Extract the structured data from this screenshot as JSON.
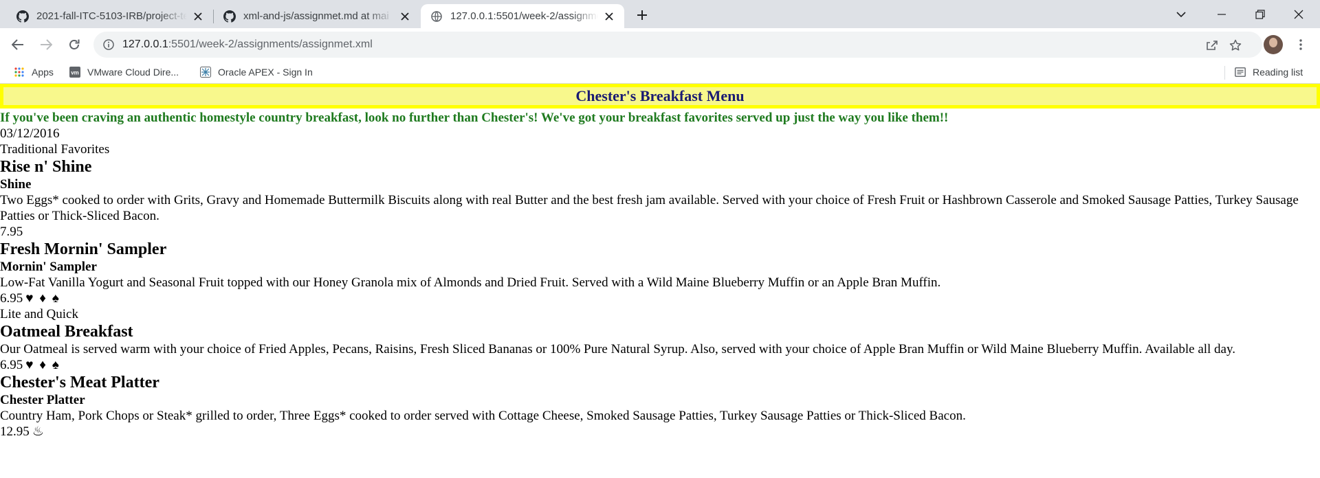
{
  "browser": {
    "tabs": [
      {
        "title": "2021-fall-ITC-5103-IRB/project-te",
        "icon": "github-icon",
        "active": false
      },
      {
        "title": "xml-and-js/assignmet.md at mai",
        "icon": "github-icon",
        "active": false
      },
      {
        "title": "127.0.0.1:5501/week-2/assignme",
        "icon": "globe-icon",
        "active": true
      }
    ],
    "url_host": "127.0.0.1",
    "url_rest": ":5501/week-2/assignments/assignmet.xml",
    "bookmarks": [
      {
        "label": "Apps",
        "icon": "apps-grid-icon"
      },
      {
        "label": "VMware Cloud Dire...",
        "icon": "vmware-icon"
      },
      {
        "label": "Oracle APEX - Sign In",
        "icon": "oracle-apex-icon"
      }
    ],
    "reading_list": "Reading list"
  },
  "menu": {
    "title": "Chester's Breakfast Menu",
    "intro": "If you've been craving an authentic homestyle country breakfast, look no further than Chester's! We've got your breakfast favorites served up just the way you like them!!",
    "date": "03/12/2016",
    "sections": [
      {
        "category": "Traditional Favorites",
        "items": [
          {
            "name": "Rise n' Shine",
            "short": "Shine",
            "description": "Two Eggs* cooked to order with Grits, Gravy and Homemade Buttermilk Biscuits along with real Butter and the best fresh jam available. Served with your choice of Fresh Fruit or Hashbrown Casserole and Smoked Sausage Patties, Turkey Sausage Patties or Thick-Sliced Bacon.",
            "price": "7.95",
            "symbols": ""
          },
          {
            "name": "Fresh Mornin' Sampler",
            "short": "Mornin' Sampler",
            "description": "Low-Fat Vanilla Yogurt and Seasonal Fruit topped with our Honey Granola mix of Almonds and Dried Fruit. Served with a Wild Maine Blueberry Muffin or an Apple Bran Muffin.",
            "price": "6.95",
            "symbols": "♥ ♦ ♠"
          }
        ]
      },
      {
        "category": "Lite and Quick",
        "items": [
          {
            "name": "Oatmeal Breakfast",
            "short": "",
            "description": "Our Oatmeal is served warm with your choice of Fried Apples, Pecans, Raisins, Fresh Sliced Bananas or 100% Pure Natural Syrup. Also, served with your choice of Apple Bran Muffin or Wild Maine Blueberry Muffin. Available all day.",
            "price": "6.95",
            "symbols": "♥ ♦ ♠"
          },
          {
            "name": "Chester's Meat Platter",
            "short": "Chester Platter",
            "description": "Country Ham, Pork Chops or Steak* grilled to order, Three Eggs* cooked to order served with Cottage Cheese, Smoked Sausage Patties, Turkey Sausage Patties or Thick-Sliced Bacon.",
            "price": "12.95",
            "symbols": "♨"
          }
        ]
      }
    ]
  }
}
